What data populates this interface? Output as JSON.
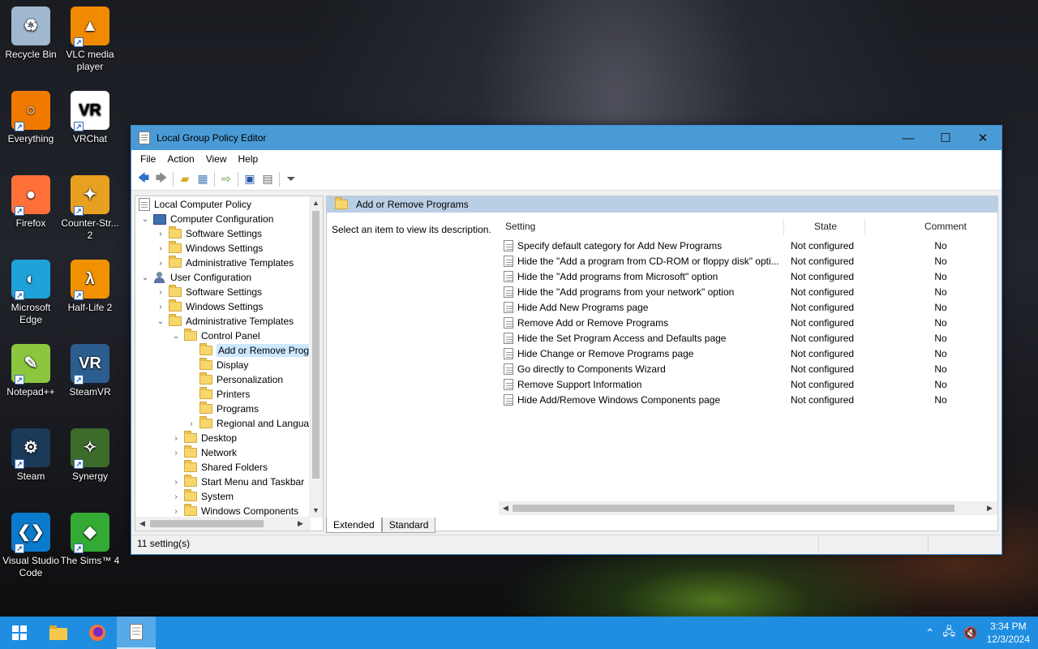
{
  "desktop_icons": [
    {
      "label": "Recycle Bin",
      "icon": "recycle-bin-icon",
      "color": "#9fb8d0"
    },
    {
      "label": "VLC media player",
      "icon": "vlc-icon",
      "color": "#f08a00"
    },
    {
      "label": "Everything",
      "icon": "everything-search-icon",
      "color": "#f07a00"
    },
    {
      "label": "VRChat",
      "icon": "vrchat-icon",
      "color": "#ffffff"
    },
    {
      "label": "Firefox",
      "icon": "firefox-icon",
      "color": "#ff7139"
    },
    {
      "label": "Counter-Str... 2",
      "icon": "counter-strike-icon",
      "color": "#e8a020"
    },
    {
      "label": "Microsoft Edge",
      "icon": "edge-icon",
      "color": "#1fa2d8"
    },
    {
      "label": "Half-Life 2",
      "icon": "half-life-icon",
      "color": "#f29100"
    },
    {
      "label": "Notepad++",
      "icon": "notepad-plus-icon",
      "color": "#8cc63f"
    },
    {
      "label": "SteamVR",
      "icon": "steamvr-icon",
      "color": "#2c5d8f"
    },
    {
      "label": "Steam",
      "icon": "steam-icon",
      "color": "#1b3a5a"
    },
    {
      "label": "Synergy",
      "icon": "synergy-icon",
      "color": "#3c6b2a"
    },
    {
      "label": "Visual Studio Code",
      "icon": "vscode-icon",
      "color": "#0a7acc"
    },
    {
      "label": "The Sims™ 4",
      "icon": "sims-icon",
      "color": "#33aa33"
    }
  ],
  "window": {
    "title": "Local Group Policy Editor",
    "minimize": "—",
    "maximize": "☐",
    "close": "✕"
  },
  "menu": [
    "File",
    "Action",
    "View",
    "Help"
  ],
  "tree": {
    "root": "Local Computer Policy",
    "computer_config": "Computer Configuration",
    "cc_software": "Software Settings",
    "cc_windows": "Windows Settings",
    "cc_admin": "Administrative Templates",
    "user_config": "User Configuration",
    "uc_software": "Software Settings",
    "uc_windows": "Windows Settings",
    "uc_admin": "Administrative Templates",
    "control_panel": "Control Panel",
    "add_remove": "Add or Remove Programs",
    "display": "Display",
    "personalization": "Personalization",
    "printers": "Printers",
    "programs": "Programs",
    "regional": "Regional and Language Options",
    "desktop": "Desktop",
    "network": "Network",
    "shared_folders": "Shared Folders",
    "start_menu": "Start Menu and Taskbar",
    "system": "System",
    "windows_components": "Windows Components"
  },
  "right": {
    "header": "Add or Remove Programs",
    "description": "Select an item to view its description.",
    "col_setting": "Setting",
    "col_state": "State",
    "col_comment": "Comment",
    "policies": [
      {
        "setting": "Specify default category for Add New Programs",
        "state": "Not configured",
        "comment": "No"
      },
      {
        "setting": "Hide the \"Add a program from CD-ROM or floppy disk\" opti...",
        "state": "Not configured",
        "comment": "No"
      },
      {
        "setting": "Hide the \"Add programs from Microsoft\" option",
        "state": "Not configured",
        "comment": "No"
      },
      {
        "setting": "Hide the \"Add programs from your network\" option",
        "state": "Not configured",
        "comment": "No"
      },
      {
        "setting": "Hide Add New Programs page",
        "state": "Not configured",
        "comment": "No"
      },
      {
        "setting": "Remove Add or Remove Programs",
        "state": "Not configured",
        "comment": "No"
      },
      {
        "setting": "Hide the Set Program Access and Defaults page",
        "state": "Not configured",
        "comment": "No"
      },
      {
        "setting": "Hide Change or Remove Programs page",
        "state": "Not configured",
        "comment": "No"
      },
      {
        "setting": "Go directly to Components Wizard",
        "state": "Not configured",
        "comment": "No"
      },
      {
        "setting": "Remove Support Information",
        "state": "Not configured",
        "comment": "No"
      },
      {
        "setting": "Hide Add/Remove Windows Components page",
        "state": "Not configured",
        "comment": "No"
      }
    ]
  },
  "tabs": {
    "extended": "Extended",
    "standard": "Standard"
  },
  "status": "11 setting(s)",
  "taskbar": {
    "time": "3:34 PM",
    "date": "12/3/2024"
  }
}
